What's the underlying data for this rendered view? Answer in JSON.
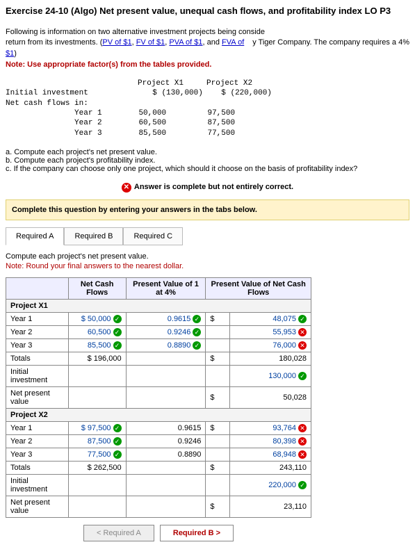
{
  "title": "Exercise 24-10 (Algo) Net present value, unequal cash flows, and profitability index LO P3",
  "intro_left": "Following is information on two alternative investment projects being conside",
  "intro_right": "y Tiger Company. The company requires a 4%",
  "intro2": "return from its investments. (",
  "link1": "PV of $1",
  "link2": "FV of $1",
  "link3": "PVA of $1",
  "link4": "FVA of $1",
  "intro2b": ", and ",
  "intro2c": ")",
  "note_red": "Note: Use appropriate factor(s) from the tables provided.",
  "mono": {
    "h1": "Initial investment",
    "h2": "Net cash flows in:",
    "ph1": "Project X1",
    "ph2": "Project X2",
    "iv1": "$ (130,000)",
    "iv2": "$ (220,000)",
    "y1": "Year 1",
    "y1a": "50,000",
    "y1b": "97,500",
    "y2": "Year 2",
    "y2a": "60,500",
    "y2b": "87,500",
    "y3": "Year 3",
    "y3a": "85,500",
    "y3b": "77,500"
  },
  "qa": "a. Compute each project's net present value.",
  "qb": "b. Compute each project's profitability index.",
  "qc": "c. If the company can choose only one project, which should it choose on the basis of profitability index?",
  "banner": "Answer is complete but not entirely correct.",
  "complete_msg": "Complete this question by entering your answers in the tabs below.",
  "tabs": {
    "a": "Required A",
    "b": "Required B",
    "c": "Required C"
  },
  "subprompt": "Compute each project's net present value.",
  "subnote": "Note: Round your final answers to the nearest dollar.",
  "col": {
    "c1": "",
    "c2": "Net Cash Flows",
    "c3": "Present Value of 1 at 4%",
    "c4": "Present Value of Net Cash Flows"
  },
  "rows": {
    "px1": "Project X1",
    "x1y1": {
      "l": "Year 1",
      "cf": "$  50,000",
      "pv": "0.9615",
      "v": "48,075",
      "cf_ok": true,
      "pv_ok": true,
      "v_ok": true
    },
    "x1y2": {
      "l": "Year 2",
      "cf": "60,500",
      "pv": "0.9246",
      "v": "55,953",
      "cf_ok": true,
      "pv_ok": true,
      "v_ok": false
    },
    "x1y3": {
      "l": "Year 3",
      "cf": "85,500",
      "pv": "0.8890",
      "v": "76,000",
      "cf_ok": true,
      "pv_ok": true,
      "v_ok": false
    },
    "x1tot": {
      "l": "Totals",
      "cf": "$ 196,000",
      "v": "180,028"
    },
    "x1init": {
      "l": "Initial investment",
      "v": "130,000",
      "v_ok": true
    },
    "x1npv": {
      "l": "Net present value",
      "v": "50,028"
    },
    "px2": "Project X2",
    "x2y1": {
      "l": "Year 1",
      "cf": "$  97,500",
      "pv": "0.9615",
      "v": "93,764",
      "cf_ok": true,
      "v_ok": false
    },
    "x2y2": {
      "l": "Year 2",
      "cf": "87,500",
      "pv": "0.9246",
      "v": "80,398",
      "cf_ok": true,
      "v_ok": false
    },
    "x2y3": {
      "l": "Year 3",
      "cf": "77,500",
      "pv": "0.8890",
      "v": "68,948",
      "cf_ok": true,
      "v_ok": false
    },
    "x2tot": {
      "l": "Totals",
      "cf": "$ 262,500",
      "v": "243,110"
    },
    "x2init": {
      "l": "Initial investment",
      "v": "220,000",
      "v_ok": true
    },
    "x2npv": {
      "l": "Net present value",
      "v": "23,110"
    }
  },
  "nav": {
    "prev": "<  Required A",
    "next": "Required B  >"
  },
  "dollar": "$"
}
